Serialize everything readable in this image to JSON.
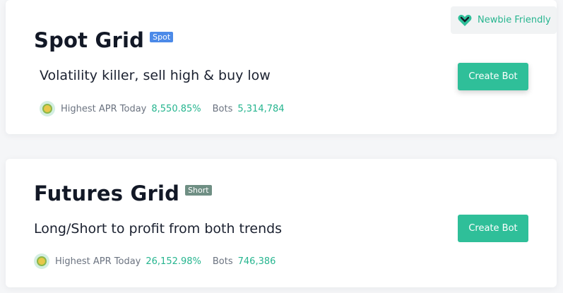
{
  "spot": {
    "title": "Spot Grid",
    "tag": "Spot",
    "subtitle": "Volatility killer, sell high & buy low",
    "apr_label": "Highest APR Today",
    "apr_value": "8,550.85%",
    "bots_label": "Bots",
    "bots_value": "5,314,784",
    "button_label": "Create Bot",
    "badge": {
      "label": "Newbie Friendly",
      "icon": "heart-icon"
    }
  },
  "futures": {
    "title": "Futures Grid",
    "tag": "Short",
    "subtitle": "Long/Short to profit from both trends",
    "apr_label": "Highest APR Today",
    "apr_value": "26,152.98%",
    "bots_label": "Bots",
    "bots_value": "746,386",
    "button_label": "Create Bot"
  },
  "colors": {
    "accent": "#2fbf99",
    "accent_text": "#26b58f",
    "spot_tag": "#4c8ae8",
    "short_tag": "#6f8f84"
  }
}
